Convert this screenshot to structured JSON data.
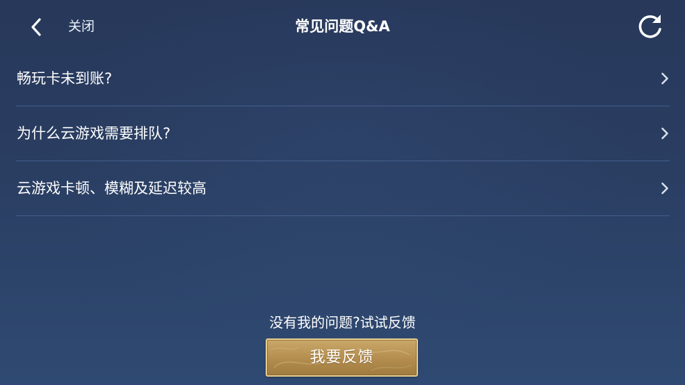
{
  "header": {
    "back_icon": "chevron-left-icon",
    "close_label": "关闭",
    "title": "常见问题Q&A",
    "refresh_icon": "refresh-icon"
  },
  "faq": {
    "items": [
      {
        "label": "畅玩卡未到账?"
      },
      {
        "label": "为什么云游戏需要排队?"
      },
      {
        "label": "云游戏卡顿、模糊及延迟较高"
      }
    ],
    "item_icon": "chevron-right-icon"
  },
  "footer": {
    "prompt": "没有我的问题?试试反馈",
    "feedback_button": "我要反馈"
  },
  "colors": {
    "background": "#2a3e62",
    "divider": "#5a7fb0",
    "button_gold": "#b58f50",
    "button_border": "#e6cf93"
  }
}
